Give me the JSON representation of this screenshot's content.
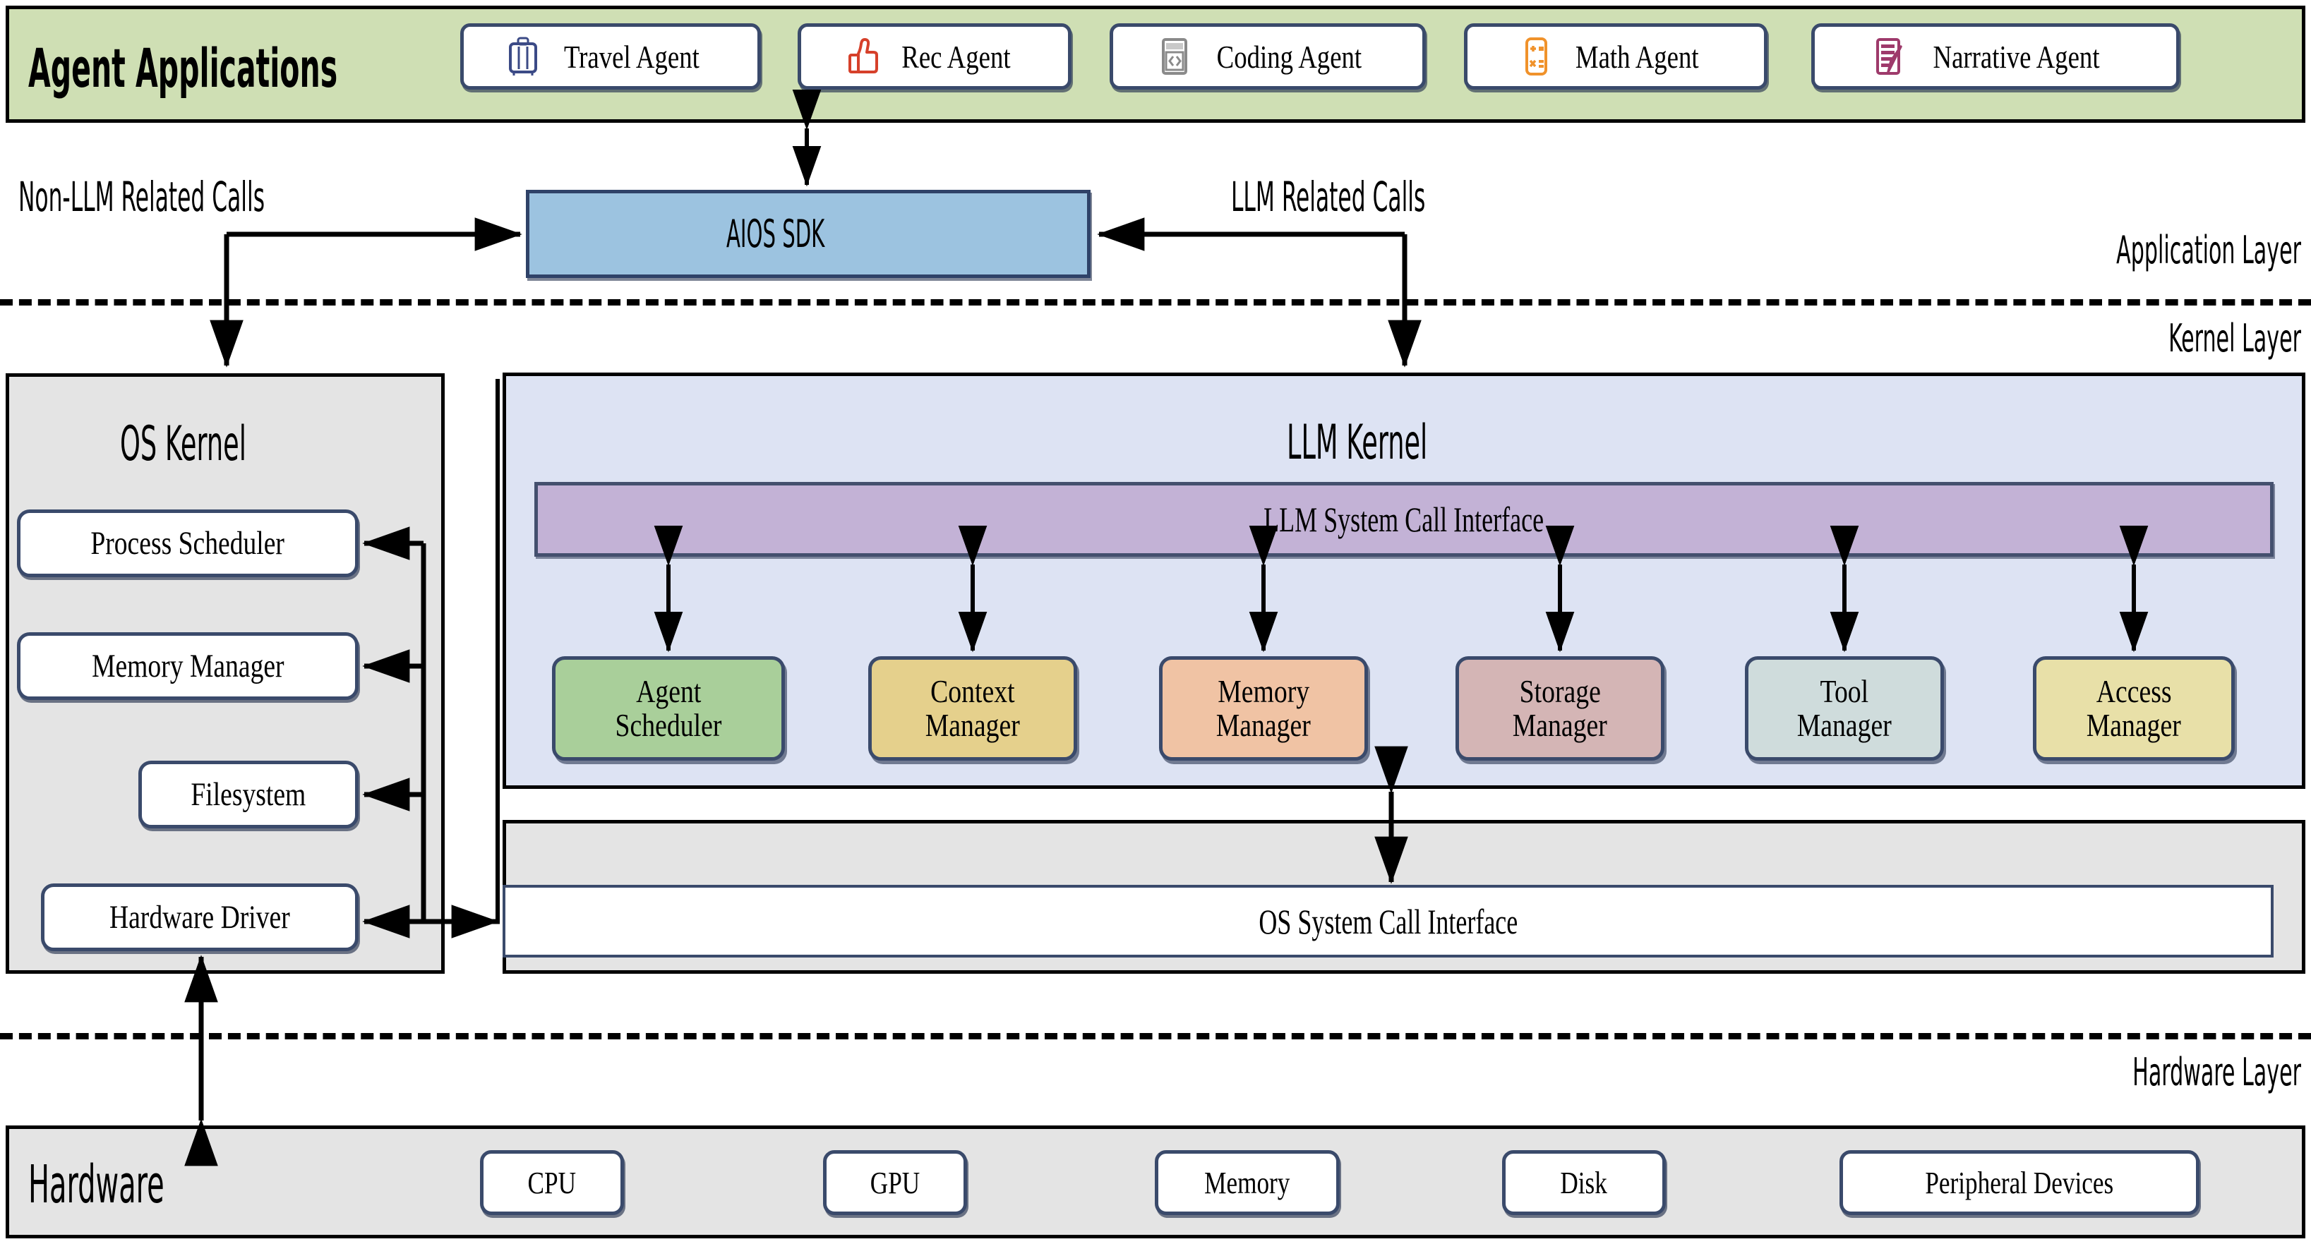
{
  "layers": [
    {
      "id": "application",
      "label": "Application Layer"
    },
    {
      "id": "kernel",
      "label": "Kernel Layer"
    },
    {
      "id": "hardware",
      "label": "Hardware Layer"
    }
  ],
  "application_layer": {
    "title": "Agent Applications",
    "band_color": "#cfdfb4",
    "agents": [
      {
        "label": "Travel Agent",
        "icon": "suitcase-icon",
        "icon_color": "#3b4a86"
      },
      {
        "label": "Rec Agent",
        "icon": "thumbs-up-icon",
        "icon_color": "#d6402a"
      },
      {
        "label": "Coding Agent",
        "icon": "code-window-icon",
        "icon_color": "#8a8a8a"
      },
      {
        "label": "Math Agent",
        "icon": "calculator-icon",
        "icon_color": "#f0922b"
      },
      {
        "label": "Narrative Agent",
        "icon": "notepad-pen-icon",
        "icon_color": "#9e3a6b"
      }
    ],
    "sdk": {
      "label": "AIOS SDK",
      "color": "#9cc3e0"
    },
    "edge_labels": {
      "left": "Non-LLM Related Calls",
      "right": "LLM Related Calls"
    }
  },
  "kernel_layer": {
    "os_kernel": {
      "title": "OS Kernel",
      "color": "#e4e4e4",
      "components": [
        {
          "label": "Process Scheduler"
        },
        {
          "label": "Memory Manager"
        },
        {
          "label": "Filesystem"
        },
        {
          "label": "Hardware Driver"
        }
      ]
    },
    "llm_kernel": {
      "title": "LLM Kernel",
      "color": "#dde3f3",
      "syscall_interface": {
        "label": "LLM System Call Interface",
        "color": "#c3b2d6"
      },
      "managers": [
        {
          "label_line1": "Agent",
          "label_line2": "Scheduler",
          "color": "#a9cf9a"
        },
        {
          "label_line1": "Context",
          "label_line2": "Manager",
          "color": "#e5d08c"
        },
        {
          "label_line1": "Memory",
          "label_line2": "Manager",
          "color": "#f0c3a4"
        },
        {
          "label_line1": "Storage",
          "label_line2": "Manager",
          "color": "#d4b5b5"
        },
        {
          "label_line1": "Tool",
          "label_line2": "Manager",
          "color": "#cfdcdc"
        },
        {
          "label_line1": "Access",
          "label_line2": "Manager",
          "color": "#e8e0a8"
        }
      ]
    },
    "os_syscall_interface": {
      "label": "OS System Call Interface",
      "color": "#ffffff"
    }
  },
  "hardware_layer": {
    "title": "Hardware",
    "color": "#e4e4e4",
    "devices": [
      {
        "label": "CPU"
      },
      {
        "label": "GPU"
      },
      {
        "label": "Memory"
      },
      {
        "label": "Disk"
      },
      {
        "label": "Peripheral Devices"
      }
    ]
  }
}
